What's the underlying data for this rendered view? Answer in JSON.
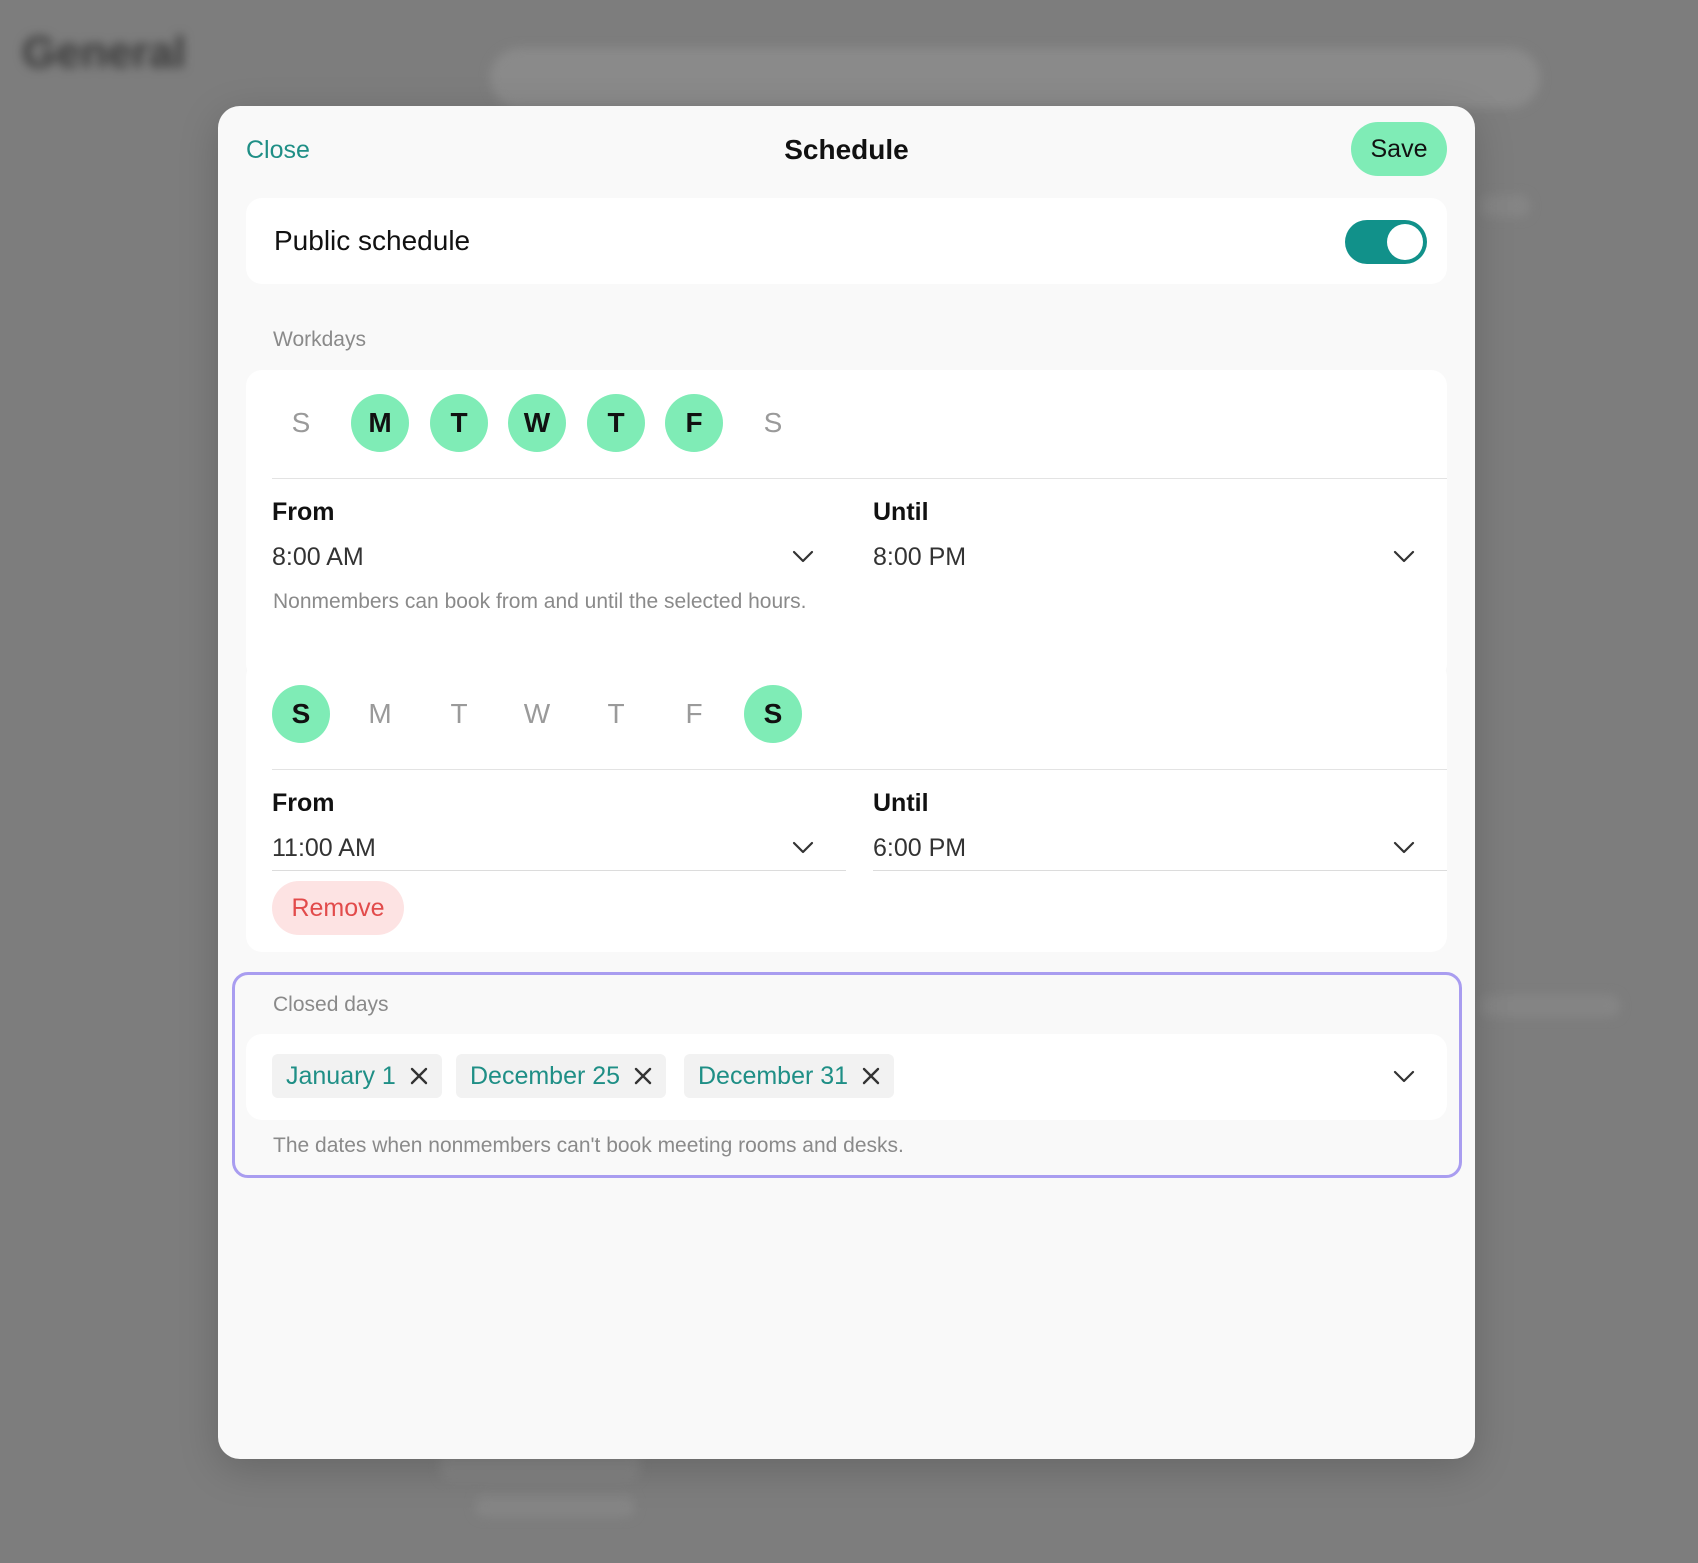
{
  "background": {
    "page_title": "General"
  },
  "modal": {
    "title": "Schedule",
    "close_label": "Close",
    "save_label": "Save",
    "public_schedule": {
      "label": "Public schedule",
      "enabled": true
    },
    "workdays_label": "Workdays",
    "schedules": [
      {
        "days": [
          {
            "letter": "S",
            "selected": false
          },
          {
            "letter": "M",
            "selected": true
          },
          {
            "letter": "T",
            "selected": true
          },
          {
            "letter": "W",
            "selected": true
          },
          {
            "letter": "T",
            "selected": true
          },
          {
            "letter": "F",
            "selected": true
          },
          {
            "letter": "S",
            "selected": false
          }
        ],
        "from_label": "From",
        "from_value": "8:00 AM",
        "until_label": "Until",
        "until_value": "8:00 PM",
        "hint": "Nonmembers can book from and until the selected hours."
      },
      {
        "days": [
          {
            "letter": "S",
            "selected": true
          },
          {
            "letter": "M",
            "selected": false
          },
          {
            "letter": "T",
            "selected": false
          },
          {
            "letter": "W",
            "selected": false
          },
          {
            "letter": "T",
            "selected": false
          },
          {
            "letter": "F",
            "selected": false
          },
          {
            "letter": "S",
            "selected": true
          }
        ],
        "from_label": "From",
        "from_value": "11:00 AM",
        "until_label": "Until",
        "until_value": "6:00 PM",
        "remove_label": "Remove"
      }
    ],
    "closed_days": {
      "label": "Closed days",
      "chips": [
        "January 1",
        "December 25",
        "December 31"
      ],
      "hint": "The dates when nonmembers can't book meeting rooms and desks."
    }
  },
  "colors": {
    "accent_green": "#7fecb6",
    "teal": "#11918a",
    "link_teal": "#1f8f86",
    "remove_red": "#e24b4b",
    "highlight_purple": "#a99df0"
  }
}
